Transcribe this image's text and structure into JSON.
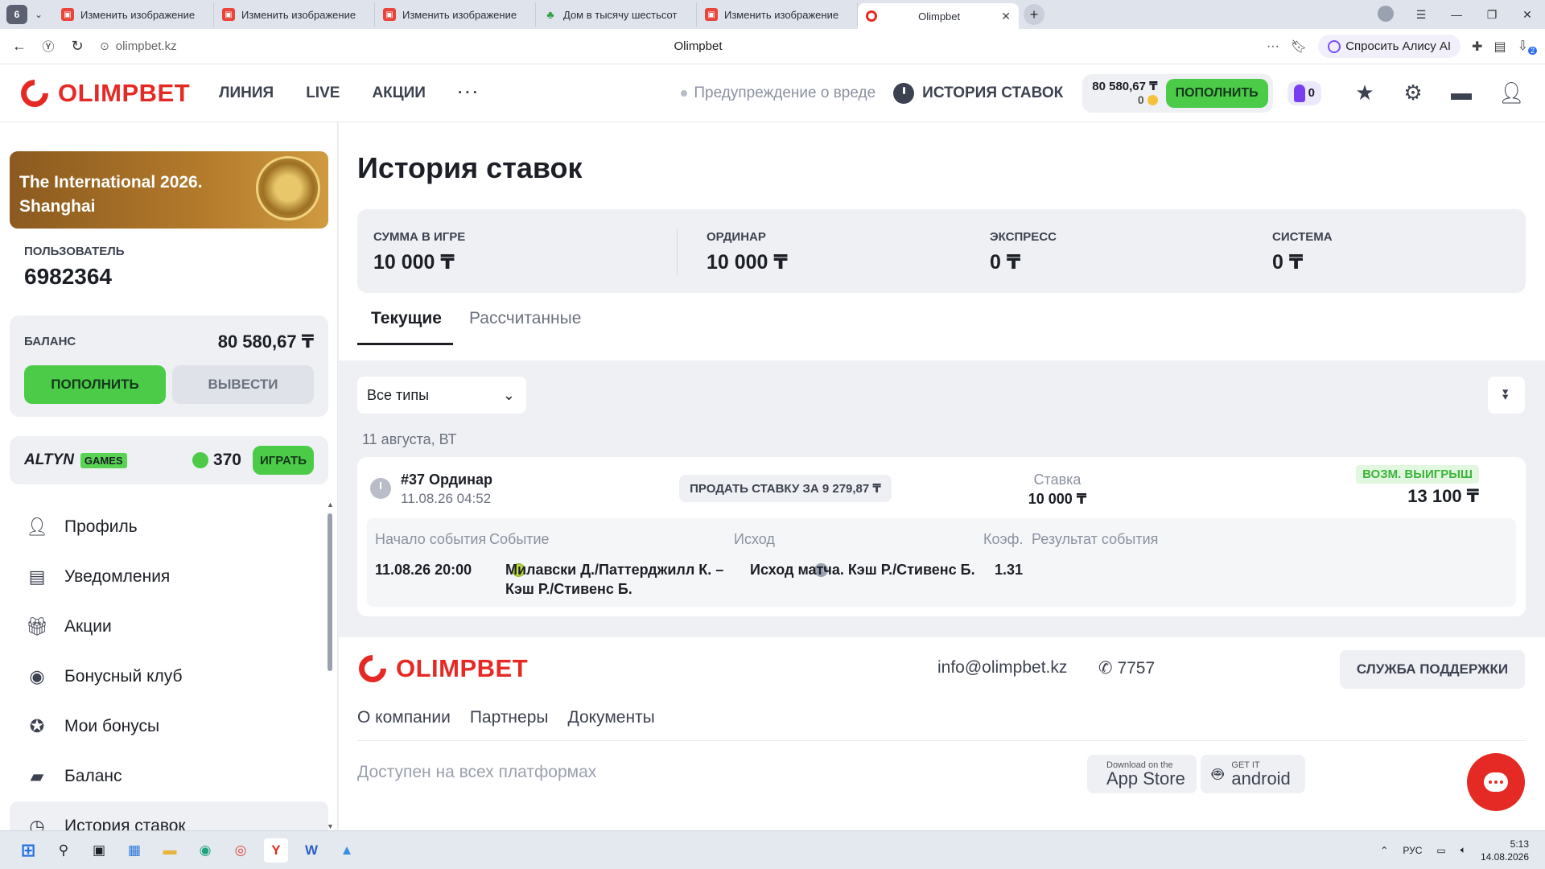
{
  "browser": {
    "tab_count": "6",
    "tabs": [
      {
        "title": "Изменить изображение"
      },
      {
        "title": "Изменить изображение"
      },
      {
        "title": "Изменить изображение"
      },
      {
        "title": "Дом в тысячу шестьсот"
      },
      {
        "title": "Изменить изображение"
      }
    ],
    "active_tab": {
      "title": "Olimpbet"
    },
    "url": "olimpbet.kz",
    "page_title": "Olimpbet",
    "alice_label": "Спросить Алису AI",
    "downloads_badge": "2"
  },
  "header": {
    "logo": "OLIMPBET",
    "nav": [
      "ЛИНИЯ",
      "LIVE",
      "АКЦИИ"
    ],
    "more": "···",
    "warning": "Предупреждение о вреде",
    "history_link": "ИСТОРИЯ СТАВОК",
    "balance": "80 580,67 ₸",
    "coins": "0",
    "topup": "ПОПОЛНИТЬ",
    "badge_count": "0"
  },
  "sidebar": {
    "promo": "The International 2026. Shanghai",
    "user_label": "ПОЛЬЗОВАТЕЛЬ",
    "user_id": "6982364",
    "balance_label": "БАЛАНС",
    "balance_value": "80 580,67 ₸",
    "topup": "ПОПОЛНИТЬ",
    "withdraw": "ВЫВЕСТИ",
    "altyn_logo": "ALTYN",
    "altyn_games": "GAMES",
    "altyn_points": "370",
    "altyn_play": "ИГРАТЬ",
    "menu": [
      {
        "label": "Профиль",
        "icon": "user-icon"
      },
      {
        "label": "Уведомления",
        "icon": "notification-icon"
      },
      {
        "label": "Акции",
        "icon": "gift-icon"
      },
      {
        "label": "Бонусный клуб",
        "icon": "bonus-club-icon"
      },
      {
        "label": "Мои бонусы",
        "icon": "star-icon"
      },
      {
        "label": "Баланс",
        "icon": "wallet-icon"
      },
      {
        "label": "История ставок",
        "icon": "clock-icon"
      }
    ]
  },
  "main": {
    "title": "История ставок",
    "stats": [
      {
        "label": "СУММА В ИГРЕ",
        "value": "10 000 ₸"
      },
      {
        "label": "ОРДИНАР",
        "value": "10 000 ₸"
      },
      {
        "label": "ЭКСПРЕСС",
        "value": "0 ₸"
      },
      {
        "label": "СИСТЕМА",
        "value": "0 ₸"
      }
    ],
    "tabs": [
      "Текущие",
      "Рассчитанные"
    ],
    "filter": "Все типы",
    "date": "11 августа, ВТ",
    "bet": {
      "title": "#37 Ординар",
      "time": "11.08.26 04:52",
      "sell": "ПРОДАТЬ СТАВКУ ЗА 9 279,87 ₸",
      "stake_label": "Ставка",
      "stake_value": "10 000 ₸",
      "win_label": "ВОЗМ. ВЫИГРЫШ",
      "win_value": "13 100 ₸",
      "headers": [
        "Начало события",
        "Событие",
        "Исход",
        "Коэф.",
        "Результат события"
      ],
      "start": "11.08.26 20:00",
      "event": "Милавски Д./Паттерджилл К. – Кэш Р./Стивенс Б.",
      "outcome": "Исход матча. Кэш Р./Стивенс Б.",
      "coef": "1.31",
      "result": ""
    }
  },
  "footer": {
    "logo": "OLIMPBET",
    "email": "info@olimpbet.kz",
    "phone": "7757",
    "support": "СЛУЖБА ПОДДЕРЖКИ",
    "links": [
      "О компании",
      "Партнеры",
      "Документы"
    ],
    "available": "Доступен на всех платформах",
    "appstore_small": "Download on the",
    "appstore_big": "App Store",
    "android_small": "GET IT",
    "android_big": "android"
  },
  "taskbar": {
    "lang": "РУС",
    "time": "5:13",
    "date": "14.08.2026"
  },
  "colors": {
    "brand_red": "#e52a25",
    "accent_green": "#4ccb49",
    "bg_gray": "#eef0f3"
  }
}
